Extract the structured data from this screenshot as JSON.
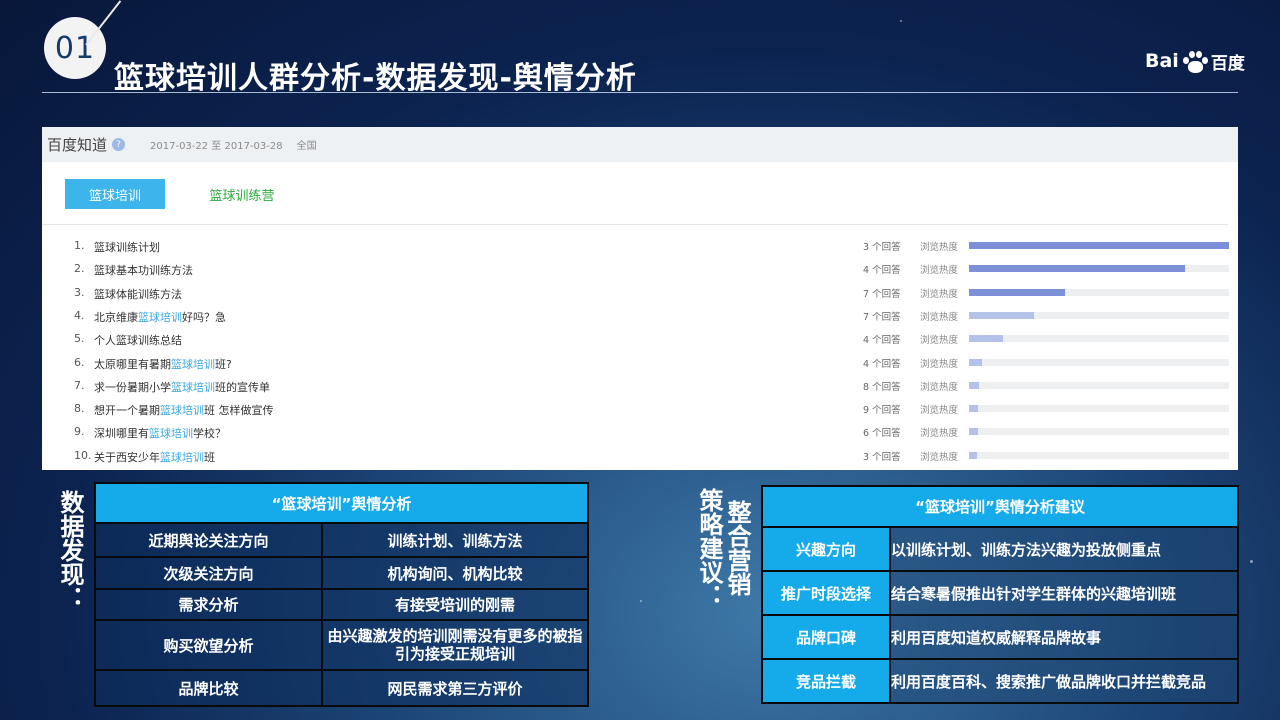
{
  "header": {
    "number": "01",
    "title": "篮球培训人群分析-数据发现-舆情分析",
    "logo_text_latin_1": "Bai",
    "logo_text_latin_2": "du",
    "logo_text_hanzi": "百度"
  },
  "panel": {
    "site_name": "百度知道",
    "help_glyph": "?",
    "date_range": "2017-03-22 至 2017-03-28",
    "region": "全国",
    "tabs": [
      "篮球培训",
      "篮球训练营"
    ],
    "heat_label": "浏览热度",
    "bar_color_high": "#7d8fd6",
    "bar_color_low": "#b4c2ea",
    "questions": [
      {
        "index": "1.",
        "parts": [
          "篮球训练计划"
        ],
        "hl": [
          false
        ],
        "answers": "3 个回答",
        "heat": 1.0
      },
      {
        "index": "2.",
        "parts": [
          "篮球基本功训练方法"
        ],
        "hl": [
          false
        ],
        "answers": "4 个回答",
        "heat": 0.83
      },
      {
        "index": "3.",
        "parts": [
          "篮球体能训练方法"
        ],
        "hl": [
          false
        ],
        "answers": "7 个回答",
        "heat": 0.37
      },
      {
        "index": "4.",
        "parts": [
          "北京维康",
          "篮球培训",
          "好吗？急"
        ],
        "hl": [
          false,
          true,
          false
        ],
        "answers": "7 个回答",
        "heat": 0.25
      },
      {
        "index": "5.",
        "parts": [
          "个人篮球训练总结"
        ],
        "hl": [
          false
        ],
        "answers": "4 个回答",
        "heat": 0.13
      },
      {
        "index": "6.",
        "parts": [
          "太原哪里有暑期",
          "篮球培训",
          "班?"
        ],
        "hl": [
          false,
          true,
          false
        ],
        "answers": "4 个回答",
        "heat": 0.05
      },
      {
        "index": "7.",
        "parts": [
          "求一份暑期小学",
          "篮球培训",
          "班的宣传单"
        ],
        "hl": [
          false,
          true,
          false
        ],
        "answers": "8 个回答",
        "heat": 0.04
      },
      {
        "index": "8.",
        "parts": [
          "想开一个暑期",
          "篮球培训",
          "班 怎样做宣传"
        ],
        "hl": [
          false,
          true,
          false
        ],
        "answers": "9 个回答",
        "heat": 0.035
      },
      {
        "index": "9.",
        "parts": [
          "深圳哪里有",
          "篮球培训",
          "学校？"
        ],
        "hl": [
          false,
          true,
          false
        ],
        "answers": "6 个回答",
        "heat": 0.035
      },
      {
        "index": "10.",
        "parts": [
          "关于西安少年",
          "篮球培训",
          "班"
        ],
        "hl": [
          false,
          true,
          false
        ],
        "answers": "3 个回答",
        "heat": 0.03
      }
    ]
  },
  "data_findings": {
    "label": "数据发现：",
    "table_title": "“篮球培训”舆情分析",
    "rows": [
      {
        "key": "近期舆论关注方向",
        "value": "训练计划、训练方法"
      },
      {
        "key": "次级关注方向",
        "value": "机构询问、机构比较"
      },
      {
        "key": "需求分析",
        "value": "有接受培训的刚需"
      },
      {
        "key": "购买欲望分析",
        "value": "由兴趣激发的培训刚需没有更多的被指引为接受正规培训"
      },
      {
        "key": "品牌比较",
        "value": "网民需求第三方评价"
      }
    ]
  },
  "strategy": {
    "label_col1": "整合营销",
    "label_col2": "策略建议：",
    "table_title": "“篮球培训”舆情分析建议",
    "rows": [
      {
        "key": "兴趣方向",
        "value": "以训练计划、训练方法兴趣为投放侧重点"
      },
      {
        "key": "推广时段选择",
        "value": "结合寒暑假推出针对学生群体的兴趣培训班"
      },
      {
        "key": "品牌口碑",
        "value": "利用百度知道权威解释品牌故事"
      },
      {
        "key": "竞品拦截",
        "value": "利用百度百科、搜索推广做品牌收口并拦截竞品"
      }
    ]
  }
}
